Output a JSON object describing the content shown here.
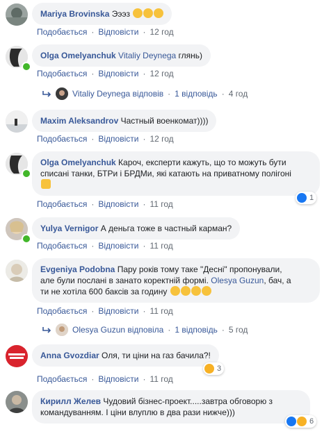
{
  "labels": {
    "like": "Подобається",
    "reply": "Відповісти",
    "sep": "·"
  },
  "comments": [
    {
      "name": "Mariya Brovinska",
      "text": "Эээз",
      "emoji": [
        "😱",
        "🤭",
        "😱"
      ],
      "time": "12 год"
    },
    {
      "name": "Olga Omelyanchuk",
      "mention": "Vitaliy Deynega",
      "text": " глянь)",
      "time": "12 год",
      "reply": {
        "author": "Vitaliy Deynega",
        "verb": "відповів",
        "count": "1 відповідь",
        "time": "4 год"
      }
    },
    {
      "name": "Maxim Aleksandrov",
      "text": "Частный военкомат))))",
      "time": "12 год"
    },
    {
      "name": "Olga Omelyanchuk",
      "text_line1": " Кароч, експерти кажуть, що то можуть бути",
      "text_line2": "списані танки, БТРи і БРДМи, які катають на приватному полігоні",
      "emoji": [
        "🤷"
      ],
      "time": "11 год",
      "reaction": {
        "icon": "like",
        "count": "1"
      }
    },
    {
      "name": "Yulya Vernigor",
      "text": " А деньга тоже в частный карман?",
      "time": "11 год"
    },
    {
      "name": "Evgeniya Podobna",
      "text_line1": " Пару років тому таке \"Десні\" пропонували,",
      "text_line2": "але були послані в занато коректній формі.",
      "mention": "Olesya Guzun",
      "text_line2b": ", бач, а",
      "text_line3": "ти не хотіла 600 баксів за годину",
      "emoji": [
        "😂",
        "😂",
        "😂",
        "😂"
      ],
      "time": "11 год",
      "reply": {
        "author": "Olesya Guzun",
        "verb": "відповіла",
        "count": "1 відповідь",
        "time": "5 год"
      }
    },
    {
      "name": "Anna Gvozdiar",
      "text": " Оля, ти ціни на газ бачила?!",
      "time": "11 год",
      "reaction": {
        "icon": "haha",
        "count": "3"
      }
    },
    {
      "name": "Кирилл Желев",
      "text_line1": " Чудовий бізнес-проект.....завтра обговорю з",
      "text_line2": "командуванням. І ціни влуплю в два рази нижче)))",
      "time": "11 год",
      "reaction": {
        "icon": "like-haha",
        "count": "6"
      }
    }
  ],
  "colors": {
    "link": "#385898",
    "bubble": "#f2f3f5",
    "meta": "#606770",
    "online": "#42b72a"
  }
}
